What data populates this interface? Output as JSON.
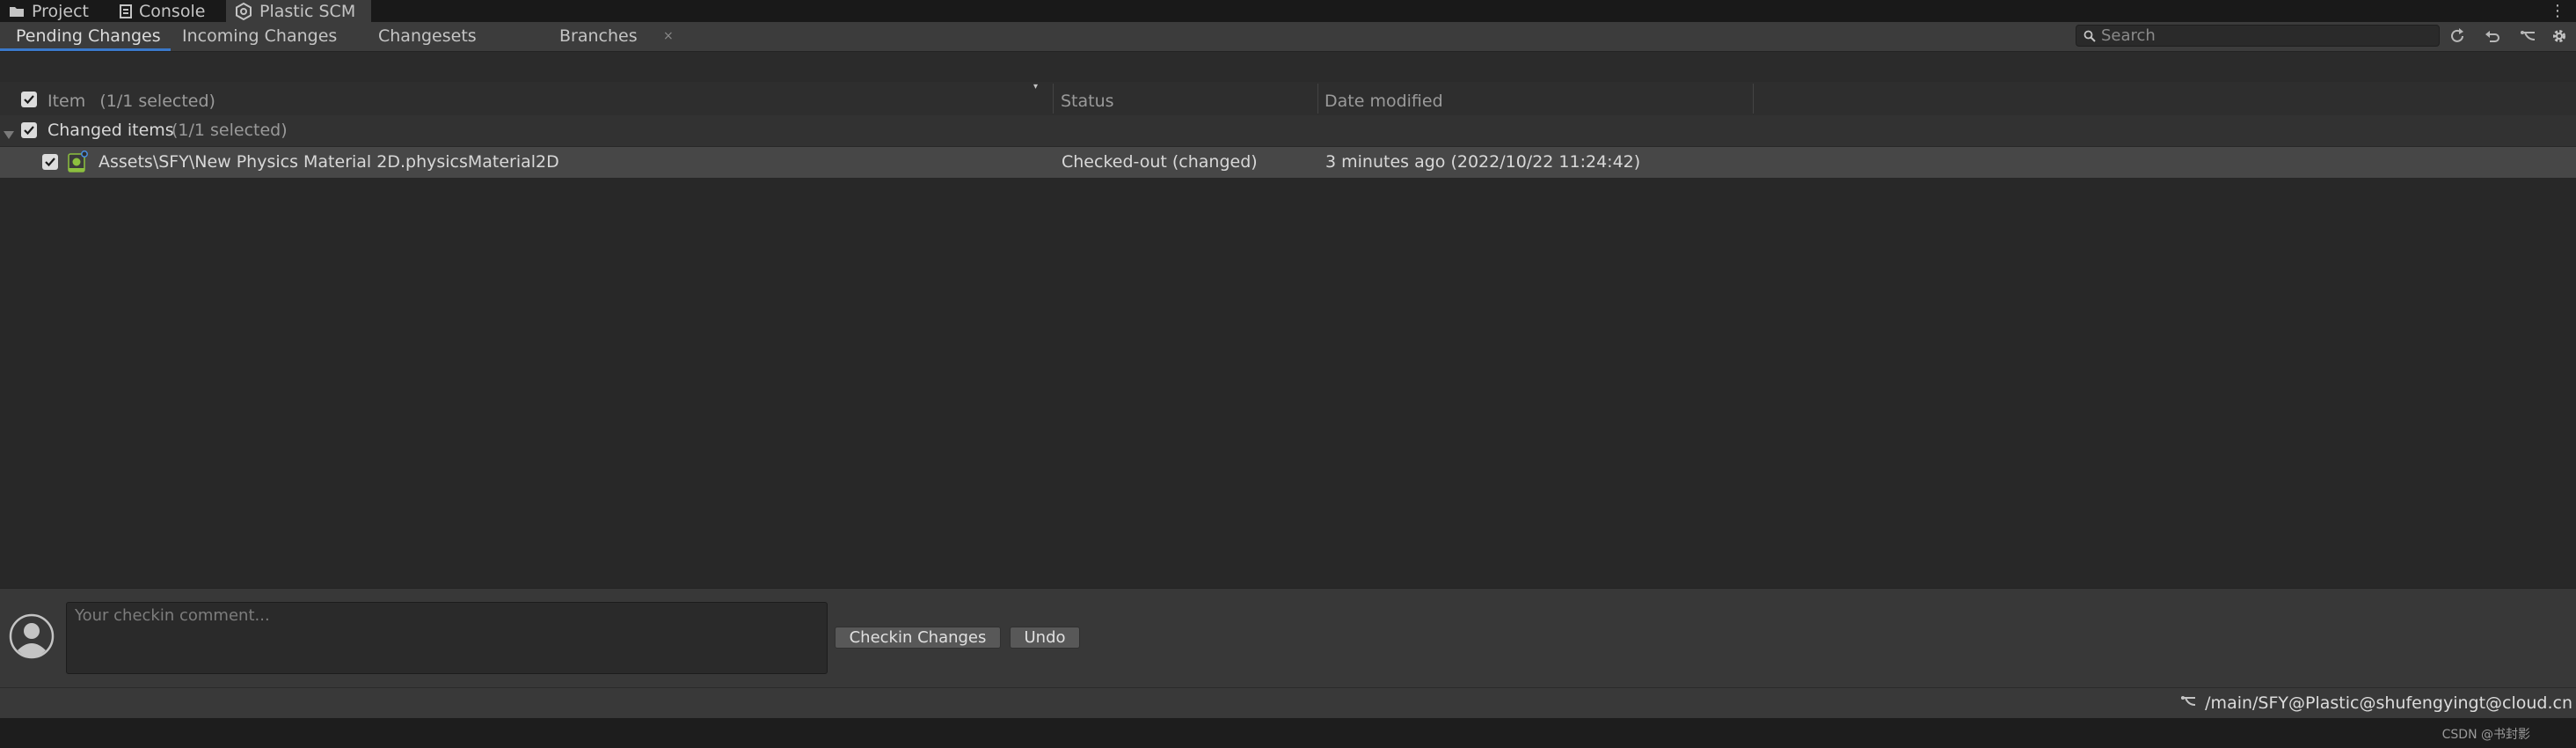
{
  "window_tabs": [
    {
      "label": "Project",
      "icon": "folder-icon"
    },
    {
      "label": "Console",
      "icon": "console-icon"
    },
    {
      "label": "Plastic SCM",
      "icon": "plastic-scm-icon",
      "active": true
    }
  ],
  "more_menu": "⋮",
  "sub_tabs": [
    {
      "label": "Pending Changes",
      "active": true
    },
    {
      "label": "Incoming Changes"
    },
    {
      "label": "Changesets"
    },
    {
      "label": "Branches"
    }
  ],
  "close_glyph": "×",
  "search": {
    "placeholder": "Search"
  },
  "toolbar_icons": [
    "refresh-icon",
    "undo-icon",
    "branch-icon",
    "settings-icon"
  ],
  "columns": {
    "item": "Item",
    "item_selection": "(1/1 selected)",
    "status": "Status",
    "date_modified": "Date modified",
    "sort_glyph": "▾"
  },
  "group": {
    "label": "Changed items",
    "selection": "(1/1 selected)"
  },
  "items": [
    {
      "path": "Assets\\SFY\\New Physics Material 2D.physicsMaterial2D",
      "status": "Checked-out (changed)",
      "date_modified": "3 minutes ago (2022/10/22 11:24:42)",
      "checked": true
    }
  ],
  "checkin": {
    "placeholder": "Your checkin comment...",
    "checkin_button": "Checkin Changes",
    "undo_button": "Undo"
  },
  "status_bar": {
    "branch": "/main/SFY@Plastic@shufengyingt@cloud.cn"
  },
  "watermark": "CSDN @书封影",
  "colors": {
    "accent": "#3a78c9",
    "selected_row": "#474747",
    "background": "#282828"
  }
}
